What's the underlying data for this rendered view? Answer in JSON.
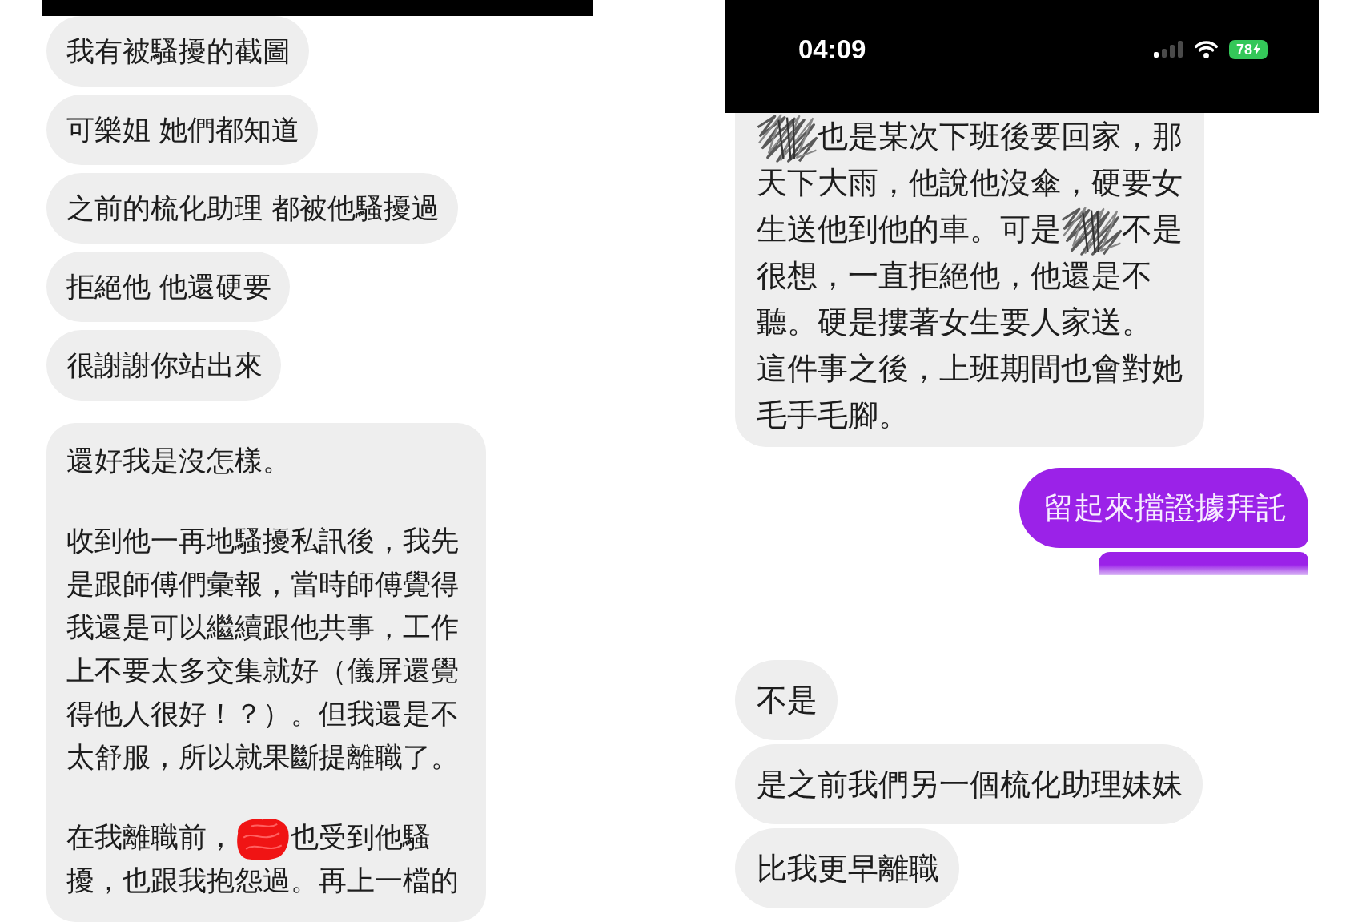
{
  "screenshots": [
    {
      "messages": [
        {
          "kind": "bubble",
          "outgoing": false,
          "cut_top": false,
          "cut_bottom": false,
          "paragraphs": [
            {
              "rows": [
                [
                  {
                    "kind": "text",
                    "text": "我有被騷擾的截圖"
                  }
                ]
              ]
            }
          ]
        },
        {
          "kind": "bubble",
          "outgoing": false,
          "cut_top": false,
          "cut_bottom": false,
          "paragraphs": [
            {
              "rows": [
                [
                  {
                    "kind": "text",
                    "text": "可樂姐 她們都知道"
                  }
                ]
              ]
            }
          ]
        },
        {
          "kind": "bubble",
          "outgoing": false,
          "cut_top": false,
          "cut_bottom": false,
          "paragraphs": [
            {
              "rows": [
                [
                  {
                    "kind": "text",
                    "text": "之前的梳化助理 都被他騷擾過"
                  }
                ]
              ]
            }
          ]
        },
        {
          "kind": "bubble",
          "outgoing": false,
          "cut_top": false,
          "cut_bottom": false,
          "paragraphs": [
            {
              "rows": [
                [
                  {
                    "kind": "text",
                    "text": "拒絕他 他還硬要"
                  }
                ]
              ]
            }
          ]
        },
        {
          "kind": "bubble",
          "outgoing": false,
          "cut_top": false,
          "cut_bottom": false,
          "paragraphs": [
            {
              "rows": [
                [
                  {
                    "kind": "text",
                    "text": "很謝謝你站出來"
                  }
                ]
              ]
            }
          ]
        },
        {
          "kind": "bubble",
          "outgoing": false,
          "cut_top": false,
          "cut_bottom": true,
          "paragraphs": [
            {
              "rows": [
                [
                  {
                    "kind": "text",
                    "text": "還好我是沒怎樣。"
                  }
                ]
              ]
            },
            {
              "rows": [
                [
                  {
                    "kind": "text",
                    "text": "收到他一再地騷擾私訊後，我先是跟師傅們彙報，當時師傅覺得我還是可以繼續跟他共事，工作上不要太多交集就好（儀屏還覺得他人很好！？）。但我還是不太舒服，所以就果斷提離職了。"
                  }
                ]
              ]
            },
            {
              "rows": [
                [
                  {
                    "kind": "text",
                    "text": "在我離職前，"
                  },
                  {
                    "kind": "marker_redaction"
                  },
                  {
                    "kind": "text",
                    "text": "也受到他騷"
                  }
                ],
                [
                  {
                    "kind": "text",
                    "text": "擾，也跟我抱怨過。再上一檔的"
                  }
                ]
              ]
            }
          ]
        }
      ]
    },
    {
      "status_bar": {
        "time": "04:09",
        "battery": "78"
      },
      "messages": [
        {
          "kind": "bubble",
          "outgoing": false,
          "cut_top": true,
          "cut_bottom": false,
          "paragraphs": [
            {
              "rows": [
                [
                  {
                    "kind": "pencil_redaction"
                  },
                  {
                    "kind": "text",
                    "text": "也是某次下班後要回家，那"
                  }
                ],
                [
                  {
                    "kind": "text",
                    "text": "天下大雨，他說他沒傘，硬要女"
                  }
                ],
                [
                  {
                    "kind": "text",
                    "text": "生送他到他的車。可是"
                  },
                  {
                    "kind": "pencil_redaction"
                  },
                  {
                    "kind": "text",
                    "text": "不是"
                  }
                ],
                [
                  {
                    "kind": "text",
                    "text": "很想，一直拒絕他，他還是不聽。硬是摟著女生要人家送。"
                  }
                ],
                [
                  {
                    "kind": "text",
                    "text": "這件事之後，上班期間也會對她毛手毛腳。"
                  }
                ]
              ]
            }
          ]
        },
        {
          "kind": "bubble",
          "outgoing": true,
          "cut_top": false,
          "cut_bottom": false,
          "paragraphs": [
            {
              "rows": [
                [
                  {
                    "kind": "text",
                    "text": "留起來擋證據拜託"
                  }
                ]
              ]
            }
          ]
        },
        {
          "kind": "cropped",
          "outgoing": true
        },
        {
          "kind": "bubble",
          "outgoing": false,
          "cut_top": false,
          "cut_bottom": false,
          "paragraphs": [
            {
              "rows": [
                [
                  {
                    "kind": "text",
                    "text": "不是"
                  }
                ]
              ]
            }
          ]
        },
        {
          "kind": "bubble",
          "outgoing": false,
          "cut_top": false,
          "cut_bottom": false,
          "paragraphs": [
            {
              "rows": [
                [
                  {
                    "kind": "text",
                    "text": "是之前我們另一個梳化助理妹妹"
                  }
                ]
              ]
            }
          ]
        },
        {
          "kind": "bubble",
          "outgoing": false,
          "cut_top": false,
          "cut_bottom": false,
          "paragraphs": [
            {
              "rows": [
                [
                  {
                    "kind": "text",
                    "text": "比我更早離職"
                  }
                ]
              ]
            }
          ]
        }
      ]
    }
  ]
}
